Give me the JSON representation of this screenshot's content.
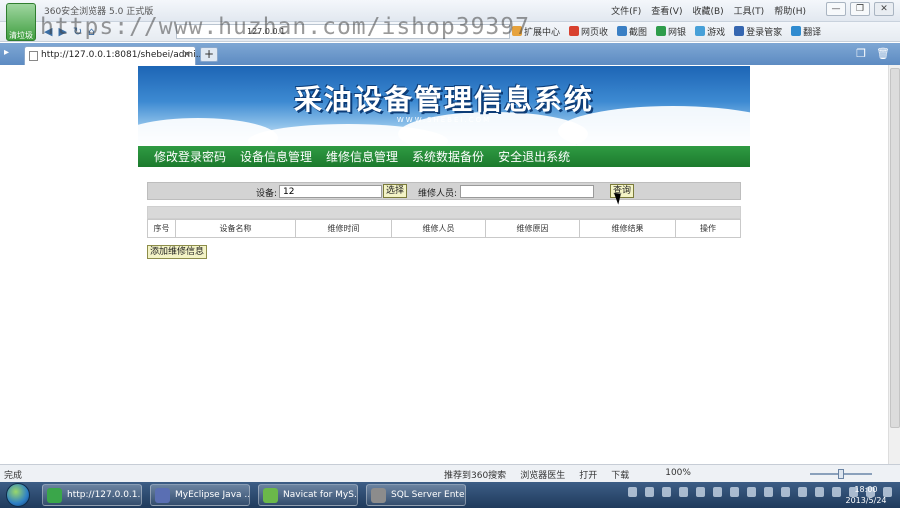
{
  "browser": {
    "app_badge": "清垃圾",
    "window_title": "360安全浏览器 5.0 正式版",
    "menu": [
      "文件(F)",
      "查看(V)",
      "收藏(B)",
      "工具(T)",
      "帮助(H)"
    ],
    "window_buttons": [
      "—",
      "❐",
      "✕"
    ],
    "toolbar_address_mini": "127.0.0.1",
    "toolbar_items": [
      "扩展中心",
      "网页收",
      "截图",
      "网银",
      "游戏",
      "登录管家",
      "翻译"
    ],
    "tab_title": "http://127.0.0.1:8081/shebei/admi...",
    "tab_close": "×",
    "new_tab": "+"
  },
  "watermark": "https://www.huzhan.com/ishop39397",
  "page": {
    "banner_title": "采油设备管理信息系统",
    "banner_sub": "WWW.SHEBEI.COM",
    "nav": [
      "修改登录密码",
      "设备信息管理",
      "维修信息管理",
      "系统数据备份",
      "安全退出系统"
    ],
    "search": {
      "equipment_label": "设备:",
      "equipment_value": "12",
      "select_button": "选择",
      "repairer_label": "维修人员:",
      "repairer_value": "",
      "query_button": "查询"
    },
    "table_headers": [
      "序号",
      "设备名称",
      "维修时间",
      "维修人员",
      "维修原因",
      "维修结果",
      "操作"
    ],
    "add_button": "添加维修信息"
  },
  "status": {
    "left": "完成",
    "items": [
      "推荐到360搜索",
      "浏览器医生",
      "打开",
      "下载"
    ],
    "zoom": "100%"
  },
  "taskbar": {
    "tasks": [
      {
        "label": "http://127.0.0.1...",
        "color": "#3aa64a"
      },
      {
        "label": "MyEclipse Java ...",
        "color": "#5a6fb3"
      },
      {
        "label": "Navicat for MyS...",
        "color": "#6bb84a"
      },
      {
        "label": "SQL Server Ente...",
        "color": "#8c8c8c"
      }
    ],
    "clock_time": "18:00",
    "clock_date": "2013/5/24"
  }
}
